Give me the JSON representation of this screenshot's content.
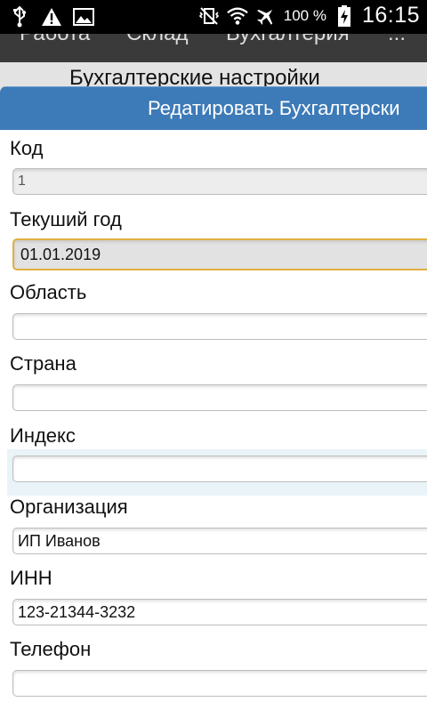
{
  "status_bar": {
    "battery_percent": "100 %",
    "time": "16:15",
    "icons": [
      "usb-icon",
      "warning-icon",
      "image-icon",
      "vibrate-icon",
      "wifi-icon",
      "airplane-mode-icon",
      "battery-charging-icon"
    ]
  },
  "app": {
    "tabs": [
      "Работа",
      "Склад",
      "Бухгалтерия",
      "..."
    ],
    "page_title": "Бухгалтерские настройки"
  },
  "dialog": {
    "title": "Редатировать Бухгалтерски",
    "fields": [
      {
        "label": "Код",
        "value": "1",
        "state": "disabled"
      },
      {
        "label": "Текуший год",
        "value": "01.01.2019",
        "state": "focused"
      },
      {
        "label": "Область",
        "value": ""
      },
      {
        "label": "Страна",
        "value": ""
      },
      {
        "label": "Индекс",
        "value": ""
      },
      {
        "label": "Организация",
        "value": "ИП Иванов"
      },
      {
        "label": "ИНН",
        "value": "123-21344-3232"
      },
      {
        "label": "Телефон",
        "value": ""
      }
    ]
  },
  "colors": {
    "dialog_header": "#3d7ab8",
    "focus_border": "#e0b040",
    "app_bar": "#3a3a3a"
  }
}
